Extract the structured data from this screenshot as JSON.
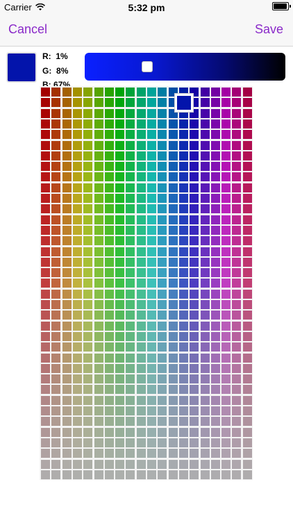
{
  "status_bar": {
    "carrier": "Carrier",
    "time": "5:32 pm"
  },
  "nav": {
    "cancel_label": "Cancel",
    "save_label": "Save"
  },
  "color": {
    "swatch_hex": "#0314AB",
    "r_label": "R:",
    "r_value": "1%",
    "g_label": "G:",
    "g_value": "8%",
    "b_label": "B:",
    "b_value": "67%"
  },
  "brightness_slider": {
    "value": 0.3,
    "start_color": "#0a20ff",
    "end_color": "#000000"
  },
  "palette": {
    "columns": 20,
    "rows": 37,
    "selected_row": 1,
    "selected_col": 13
  },
  "accent_color": "#8a2ac9",
  "icons": {
    "wifi": "wifi-icon",
    "battery": "battery-icon"
  }
}
